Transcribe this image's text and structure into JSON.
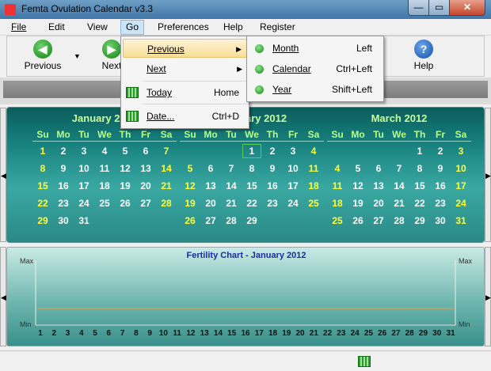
{
  "window": {
    "title": "Femta Ovulation Calendar v3.3",
    "min_glyph": "—",
    "max_glyph": "▭",
    "close_glyph": "✕"
  },
  "menubar": [
    "File",
    "Edit",
    "View",
    "Go",
    "Preferences",
    "Help",
    "Register"
  ],
  "toolbar": {
    "previous": "Previous",
    "next": "Next",
    "help": "Help"
  },
  "go_menu": {
    "items": [
      {
        "label": "Previous",
        "shortcut": "",
        "submenu": true
      },
      {
        "label": "Next",
        "shortcut": "",
        "submenu": true
      },
      {
        "label": "Today",
        "shortcut": "Home"
      },
      {
        "label": "Date...",
        "shortcut": "Ctrl+D"
      }
    ]
  },
  "previous_submenu": {
    "items": [
      {
        "label": "Month",
        "shortcut": "Left"
      },
      {
        "label": "Calendar",
        "shortcut": "Ctrl+Left"
      },
      {
        "label": "Year",
        "shortcut": "Shift+Left"
      }
    ]
  },
  "calendar": {
    "day_headers": [
      "Su",
      "Mo",
      "Tu",
      "We",
      "Th",
      "Fr",
      "Sa"
    ],
    "months": [
      {
        "title": "January 2012",
        "weeks": [
          [
            "1",
            "2",
            "3",
            "4",
            "5",
            "6",
            "7"
          ],
          [
            "8",
            "9",
            "10",
            "11",
            "12",
            "13",
            "14"
          ],
          [
            "15",
            "16",
            "17",
            "18",
            "19",
            "20",
            "21"
          ],
          [
            "22",
            "23",
            "24",
            "25",
            "26",
            "27",
            "28"
          ],
          [
            "29",
            "30",
            "31",
            "",
            "",
            "",
            ""
          ]
        ]
      },
      {
        "title": "February 2012",
        "weeks": [
          [
            "",
            "",
            "",
            "1",
            "2",
            "3",
            "4"
          ],
          [
            "5",
            "6",
            "7",
            "8",
            "9",
            "10",
            "11"
          ],
          [
            "12",
            "13",
            "14",
            "15",
            "16",
            "17",
            "18"
          ],
          [
            "19",
            "20",
            "21",
            "22",
            "23",
            "24",
            "25"
          ],
          [
            "26",
            "27",
            "28",
            "29",
            "",
            "",
            ""
          ]
        ]
      },
      {
        "title": "March 2012",
        "weeks": [
          [
            "",
            "",
            "",
            "",
            "1",
            "2",
            "3"
          ],
          [
            "4",
            "5",
            "6",
            "7",
            "8",
            "9",
            "10"
          ],
          [
            "11",
            "12",
            "13",
            "14",
            "15",
            "16",
            "17"
          ],
          [
            "18",
            "19",
            "20",
            "21",
            "22",
            "23",
            "24"
          ],
          [
            "25",
            "26",
            "27",
            "28",
            "29",
            "30",
            "31"
          ]
        ]
      }
    ]
  },
  "chart": {
    "title": "Fertility Chart  -  January 2012",
    "y_max_label": "Max",
    "y_min_label": "Min",
    "x_days": [
      "1",
      "2",
      "3",
      "4",
      "5",
      "6",
      "7",
      "8",
      "9",
      "10",
      "11",
      "12",
      "13",
      "14",
      "15",
      "16",
      "17",
      "18",
      "19",
      "20",
      "21",
      "22",
      "23",
      "24",
      "25",
      "26",
      "27",
      "28",
      "29",
      "30",
      "31"
    ],
    "line_color": "#c8a060"
  },
  "arrows": {
    "left": "◀",
    "right": "▶",
    "submenu": "▶",
    "dropdown": "▼"
  }
}
